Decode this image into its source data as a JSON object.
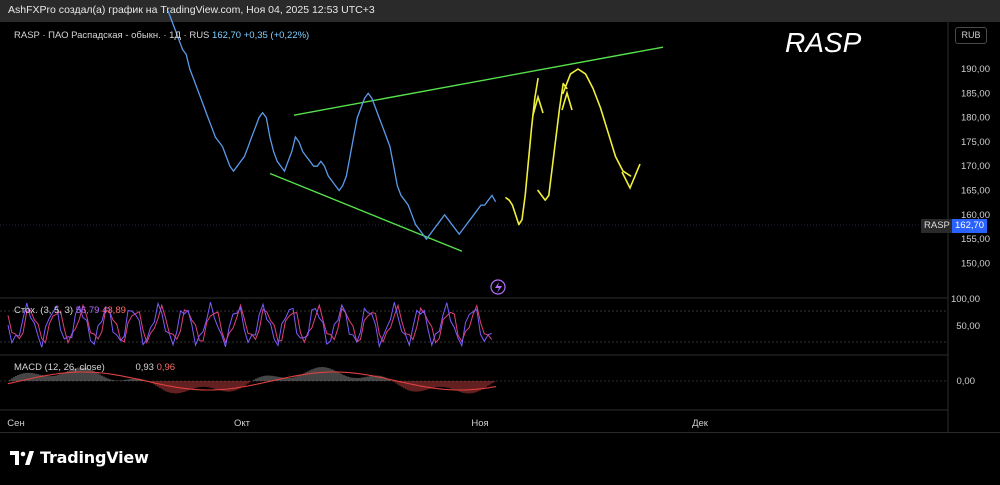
{
  "caption": "AshFXPro создал(а) график на TradingView.com, Ноя 04, 2025 12:53 UTC+3",
  "legend": {
    "symbol": "RASP · ПАО Распадская - обыкн. · 1Д · RUS",
    "price": "162,70",
    "change": "+0,35 (+0,22%)"
  },
  "ticker_overlay": "RASP",
  "currency_button": "RUB",
  "price_tag": {
    "symbol": "RASP",
    "value": "162,70"
  },
  "price_axis": [
    "190,00",
    "185,00",
    "180,00",
    "175,00",
    "170,00",
    "165,00",
    "160,00",
    "155,00",
    "150,00"
  ],
  "stoch": {
    "label": "Стох. (3, 5, 3)",
    "k": "56,79",
    "d": "43,89",
    "axis": [
      "100,00",
      "50,00"
    ]
  },
  "macd": {
    "label": "MACD (12, 26, close)",
    "hist": "0,93",
    "signal": "0,96",
    "axis": "0,00"
  },
  "time_axis": [
    "Сен",
    "Окт",
    "Ноя",
    "Дек"
  ],
  "brand": "TradingView",
  "colors": {
    "price_line": "#5b9bea",
    "trendline": "#56e04c",
    "projection": "#f0f03a",
    "stoch_k": "#7a5cff",
    "stoch_d": "#e0407a",
    "macd_pos": "#8a8a8a",
    "macd_neg": "#c54040",
    "accent": "#2962ff"
  },
  "chart_data": {
    "type": "line",
    "xlabel": "",
    "ylabel": "",
    "ylim": [
      150,
      195
    ],
    "series": [
      {
        "values": [
          202,
          200,
          198,
          196,
          194,
          193,
          190,
          188,
          186,
          184,
          182,
          180,
          178,
          176,
          175,
          174,
          172,
          170,
          169,
          170,
          171,
          172,
          174,
          176,
          178,
          180,
          181,
          180,
          176,
          173,
          171,
          170,
          169,
          171,
          173,
          176,
          175,
          173,
          172,
          171,
          170,
          170,
          171,
          170,
          168,
          167,
          166,
          165,
          166,
          168,
          172,
          176,
          180,
          182,
          184,
          185,
          184,
          182,
          180,
          178,
          176,
          174,
          170,
          166,
          164,
          163,
          162,
          160,
          158,
          157,
          156,
          155,
          156,
          157,
          158,
          159,
          160,
          159,
          158,
          157,
          156,
          157,
          158,
          159,
          160,
          161,
          162,
          162,
          163,
          164,
          162.7
        ]
      }
    ],
    "projection_1": [
      163.5,
      163,
      162,
      160,
      158,
      159,
      164,
      171,
      178,
      184,
      188
    ],
    "projection_2": [
      165,
      164,
      163,
      164,
      170,
      176,
      182,
      187,
      186
    ],
    "projection_3": [
      185,
      189,
      190,
      189,
      186,
      182,
      177,
      172,
      169,
      168
    ]
  }
}
